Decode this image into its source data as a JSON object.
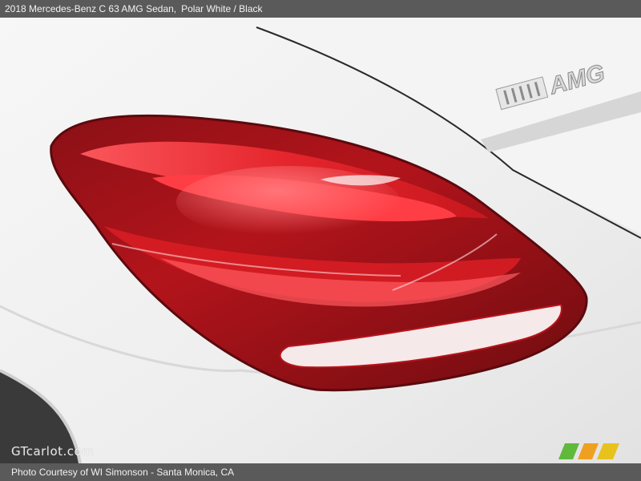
{
  "header": {
    "title": "2018 Mercedes-Benz C 63 AMG Sedan,",
    "color": "Polar White / Black"
  },
  "photo": {
    "badge_text": "AMG",
    "watermark": "GTcarlot.com",
    "logo_text": "GTcarlot"
  },
  "footer": {
    "credit": "Photo Courtesy of WI Simonson - Santa Monica, CA"
  },
  "colors": {
    "bar": "#5a5a5a",
    "paint": "#f2f2f2",
    "lamp_red": "#c8181e",
    "lamp_dark": "#6e0c10"
  }
}
